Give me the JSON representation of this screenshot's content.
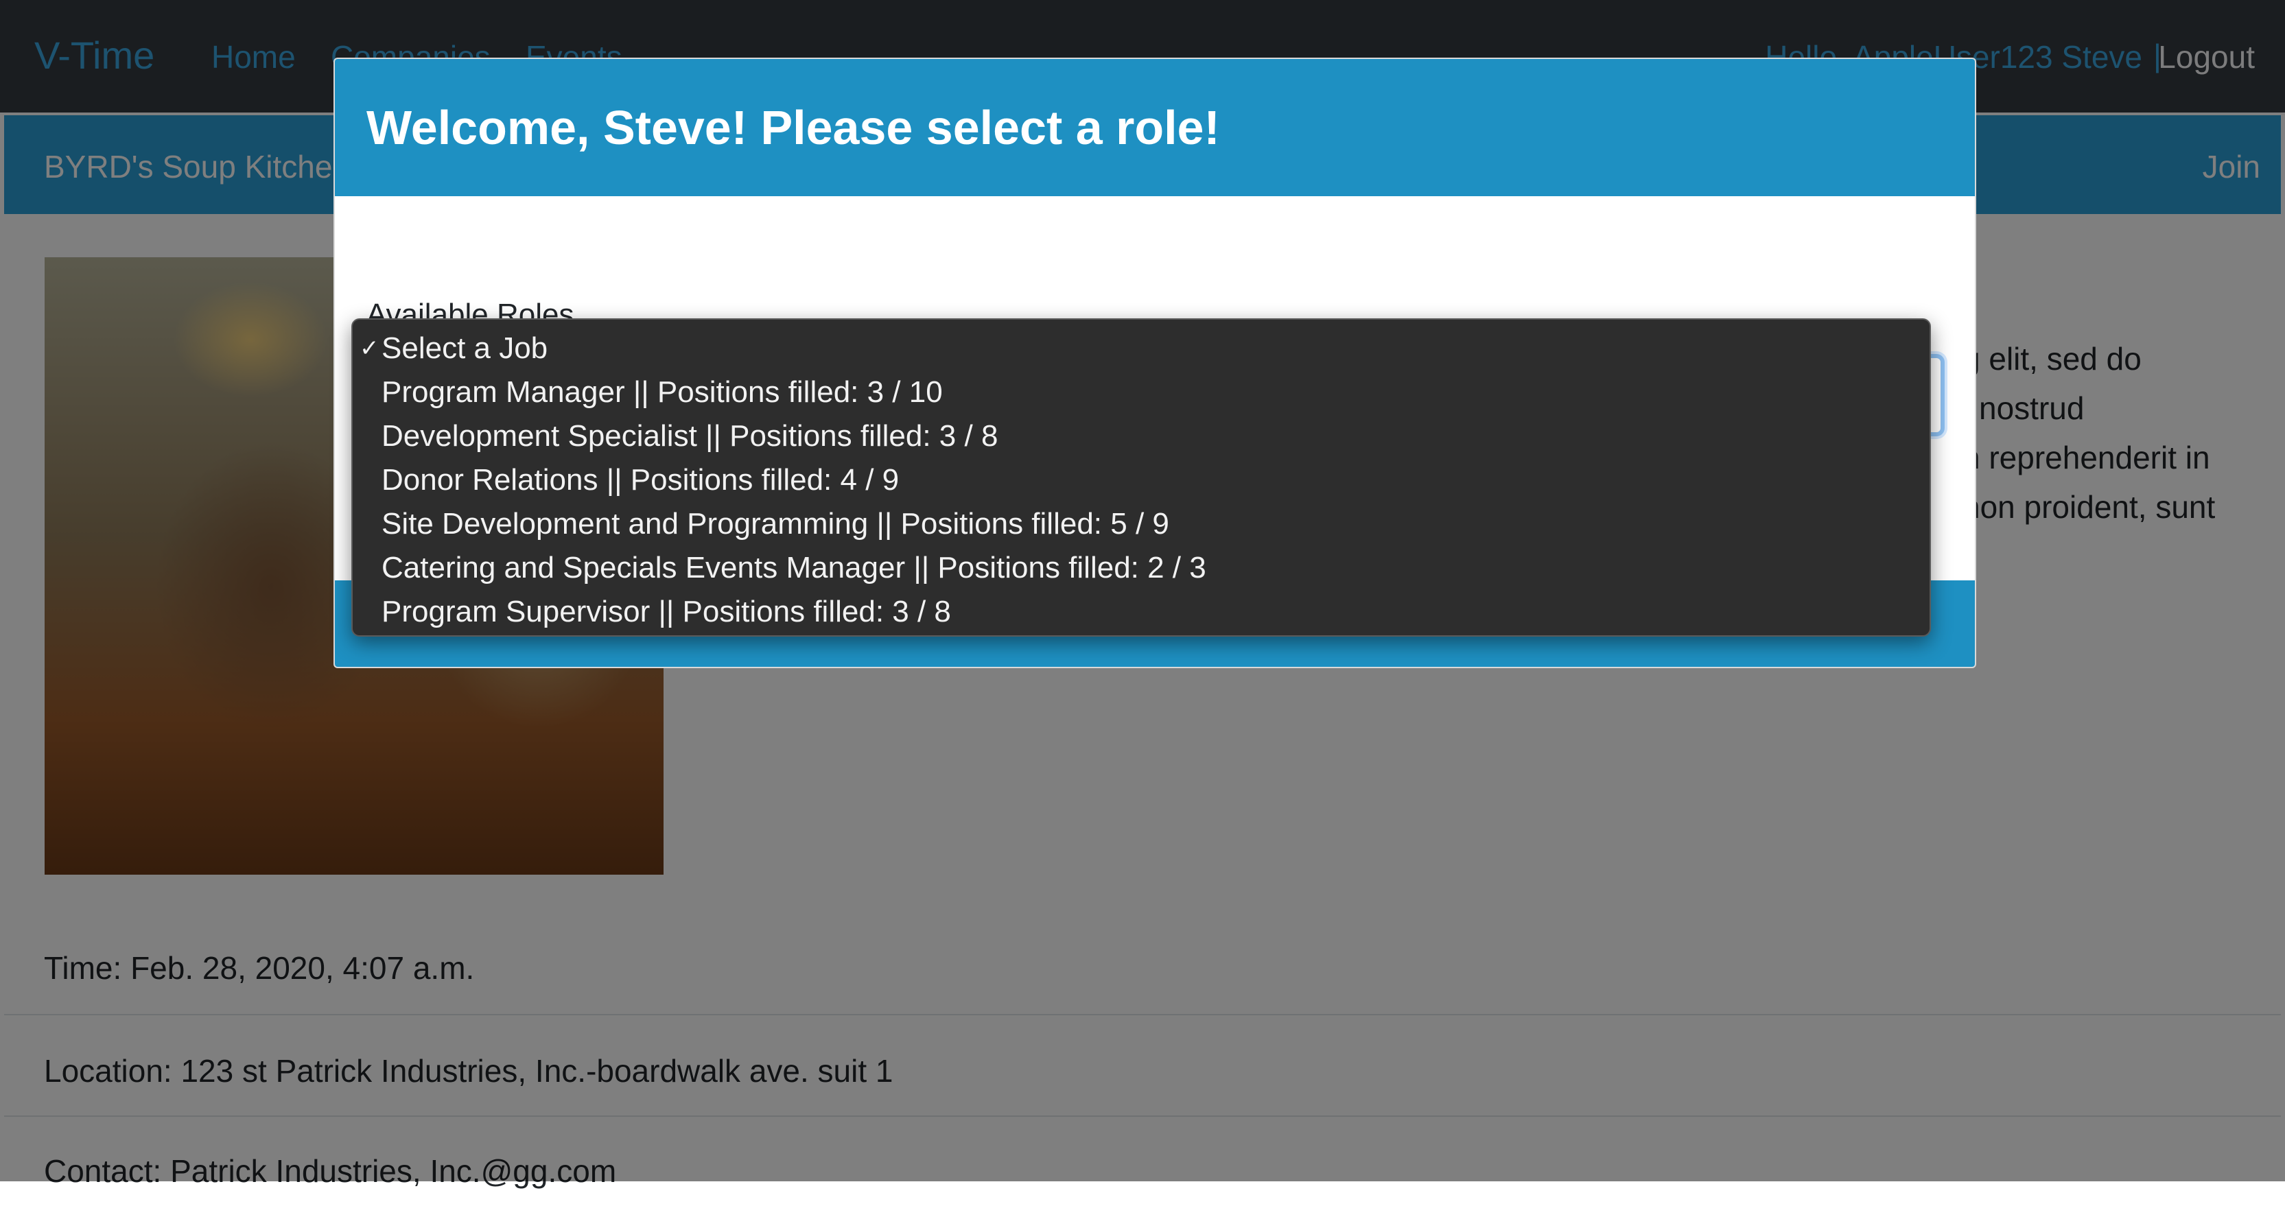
{
  "navbar": {
    "brand": "V-Time",
    "links": [
      "Home",
      "Companies",
      "Events"
    ],
    "greeting": "Hello, AppleUser123 Steve",
    "separator": "|",
    "logout": "Logout"
  },
  "event_bar": {
    "name": "BYRD's Soup Kitchen",
    "join": "Join"
  },
  "description_visible": [
    "g elit, sed do",
    "nostrud",
    "n reprehenderit in",
    "non proident, sunt"
  ],
  "details": {
    "time": "Time: Feb. 28, 2020, 4:07 a.m.",
    "location": "Location: 123 st Patrick Industries, Inc.-boardwalk ave. suit 1",
    "contact": "Contact: Patrick Industries, Inc.@gg.com"
  },
  "modal": {
    "title": "Welcome, Steve! Please select a role!",
    "roles_label": "Available Roles",
    "selected_value": "Select a Job",
    "checkmark": "✓",
    "options": [
      "Select a Job",
      "Program Manager || Positions filled: 3 / 10",
      "Development Specialist || Positions filled: 3 / 8",
      "Donor Relations || Positions filled: 4 / 9",
      "Site Development and Programming || Positions filled: 5 / 9",
      "Catering and Specials Events Manager || Positions filled: 2 / 3",
      "Program Supervisor || Positions filled: 3 / 8"
    ]
  },
  "colors": {
    "navbar_bg": "#343a40",
    "brand_blue": "#3aa6e0",
    "modal_blue": "#1e90c2",
    "dropdown_bg": "#2d2d2d"
  }
}
